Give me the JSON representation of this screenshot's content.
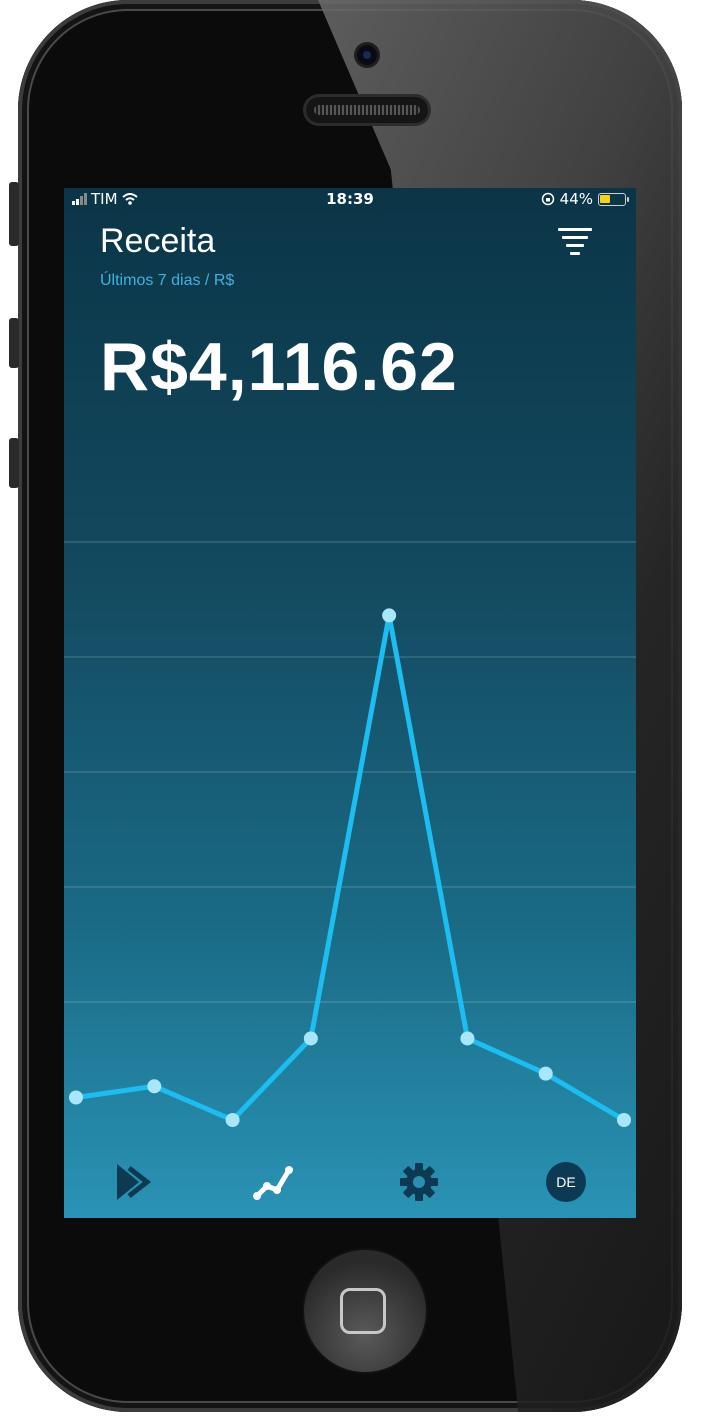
{
  "status_bar": {
    "carrier": "TIM",
    "time": "18:39",
    "battery_percent": "44%",
    "battery_level": 0.44,
    "icons": [
      "signal-icon",
      "wifi-icon",
      "orientation-lock-icon",
      "battery-icon"
    ]
  },
  "header": {
    "title": "Receita",
    "subtitle": "Últimos 7 dias / R$",
    "filter_icon": "filter-icon"
  },
  "summary": {
    "total": "R$4,116.62"
  },
  "chart_data": {
    "type": "line",
    "title": "",
    "xlabel": "",
    "ylabel": "",
    "grid": true,
    "legend": "none",
    "series": [
      {
        "values": [
          1.6,
          2.4,
          0,
          5.8,
          35.9,
          5.8,
          3.3,
          0
        ]
      }
    ]
  },
  "tab_bar": {
    "items": [
      {
        "icon": "forward-chevrons-icon"
      },
      {
        "icon": "trend-line-icon"
      },
      {
        "icon": "gear-icon"
      },
      {
        "icon": "avatar-icon",
        "label": "DE"
      }
    ]
  },
  "colors": {
    "line": "#1cbdf0",
    "point": "#a8e6fb",
    "subtitle": "#3fb2e0",
    "background_top": "#0b3547",
    "background_bottom": "#2a93b5"
  }
}
